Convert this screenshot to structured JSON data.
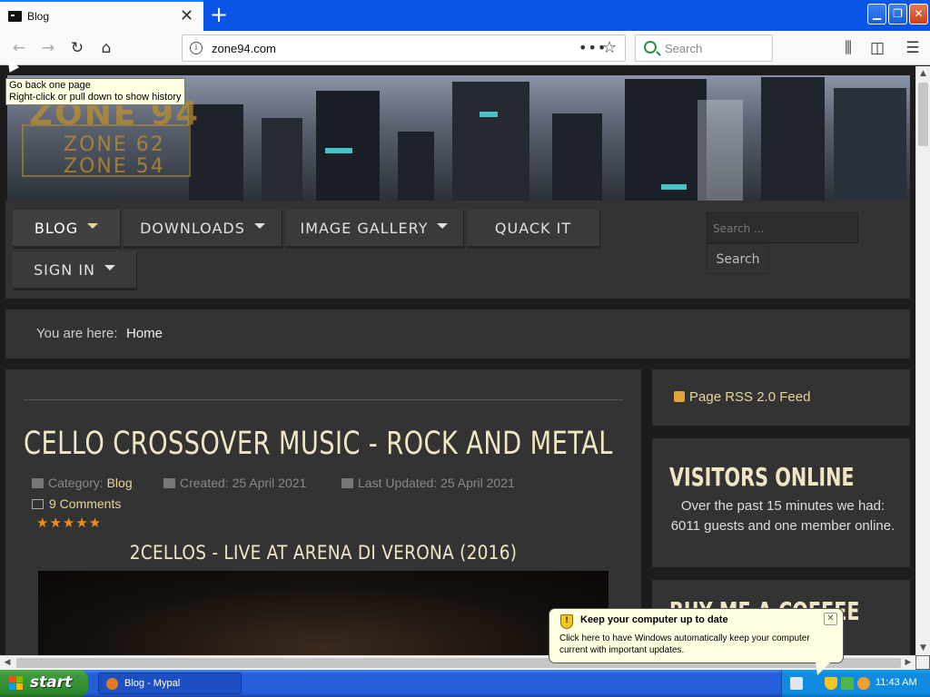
{
  "browser": {
    "tab_title": "Blog",
    "url": "zone94.com",
    "search_placeholder": "Search",
    "tooltip_line1": "Go back one page",
    "tooltip_line2": "Right-click or pull down to show history"
  },
  "site": {
    "logo_line1": "ZONE 94",
    "logo_line2": "ZONE 62",
    "logo_line3": "ZONE 54",
    "menu": [
      {
        "label": "BLOG"
      },
      {
        "label": "DOWNLOADS"
      },
      {
        "label": "IMAGE GALLERY"
      },
      {
        "label": "QUACK IT"
      },
      {
        "label": "SIGN IN"
      }
    ],
    "search_placeholder": "Search ...",
    "search_button": "Search",
    "breadcrumb_label": "You are here:",
    "breadcrumb_home": "Home"
  },
  "article": {
    "title": "CELLO CROSSOVER MUSIC - ROCK AND METAL",
    "category_label": "Category:",
    "category_value": "Blog",
    "created": "Created: 25 April 2021",
    "updated": "Last Updated: 25 April 2021",
    "comments": "9 Comments",
    "stars": "★★★★★",
    "video_title": "2CELLOS - LIVE AT ARENA DI VERONA (2016)"
  },
  "sidebar": {
    "rss": "Page RSS 2.0 Feed",
    "visitors_title": "VISITORS ONLINE",
    "visitors_text": "Over the past 15 minutes we had: 6011 guests and one member online.",
    "coffee_title": "BUY ME A COFFEE"
  },
  "notification": {
    "title": "Keep your computer up to date",
    "text": "Click here to have Windows automatically keep your computer current with important updates."
  },
  "taskbar": {
    "start": "start",
    "task": "Blog - Mypal",
    "time": "11:43 AM"
  },
  "colors": {
    "accent_gold": "#e8d59a",
    "title_cream": "#f1e6c4",
    "star_orange": "#ef8c1e",
    "xp_blue": "#245edb"
  }
}
